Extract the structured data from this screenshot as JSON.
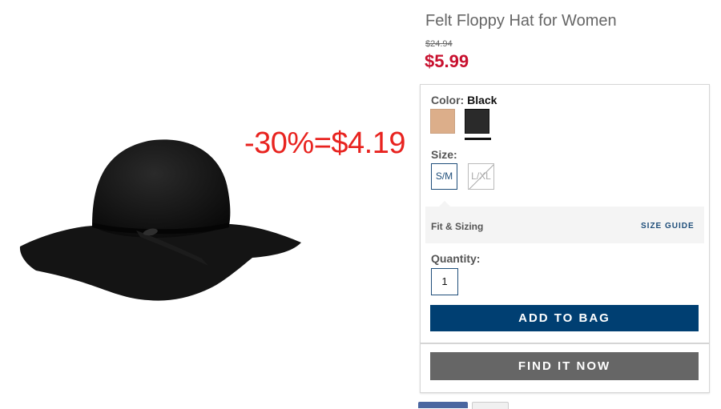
{
  "product": {
    "title": "Felt Floppy Hat for Women",
    "original_price": "$24.94",
    "sale_price": "$5.99"
  },
  "annotation": "-30%=$4.19",
  "options": {
    "color_label": "Color:",
    "color_value": "Black",
    "swatches": [
      {
        "name": "tan",
        "color": "#dcae8a"
      },
      {
        "name": "black",
        "color": "#2a2a2a"
      }
    ],
    "size_label": "Size:",
    "sizes": [
      "S/M",
      "L/XL"
    ],
    "fit_label": "Fit & Sizing",
    "size_guide_label": "SIZE GUIDE",
    "quantity_label": "Quantity:",
    "quantity_value": "1",
    "add_to_bag": "ADD TO BAG",
    "find_it_now": "FIND IT NOW"
  },
  "colors": {
    "sale": "#c8102e",
    "annotation": "#e8231f",
    "primary_button": "#003f72",
    "secondary_button": "#666666",
    "link": "#1f4e7a"
  }
}
